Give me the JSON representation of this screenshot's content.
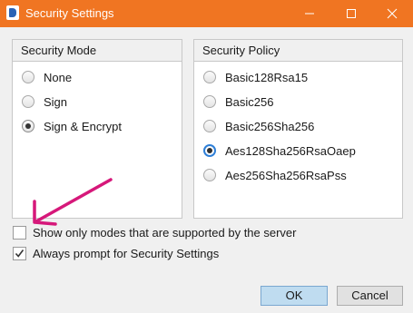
{
  "window": {
    "title": "Security Settings",
    "icon": "app-logo-icon",
    "controls": [
      "minimize-icon",
      "maximize-icon",
      "close-icon"
    ]
  },
  "security_mode": {
    "header": "Security Mode",
    "options": [
      {
        "label": "None",
        "selected": false
      },
      {
        "label": "Sign",
        "selected": false
      },
      {
        "label": "Sign & Encrypt",
        "selected": true
      }
    ]
  },
  "security_policy": {
    "header": "Security Policy",
    "options": [
      {
        "label": "Basic128Rsa15",
        "selected": false
      },
      {
        "label": "Basic256",
        "selected": false
      },
      {
        "label": "Basic256Sha256",
        "selected": false
      },
      {
        "label": "Aes128Sha256RsaOaep",
        "selected": true
      },
      {
        "label": "Aes256Sha256RsaPss",
        "selected": false
      }
    ]
  },
  "options": {
    "show_supported_only": {
      "label": "Show only modes that are supported by the server",
      "checked": false
    },
    "always_prompt": {
      "label": "Always prompt for Security Settings",
      "checked": true
    }
  },
  "buttons": {
    "ok": "OK",
    "cancel": "Cancel"
  },
  "colors": {
    "titlebar": "#f07522",
    "focus_ring": "#2f7fd7",
    "ok_button": "#bfdcf0",
    "annotation_arrow": "#d6187a"
  }
}
